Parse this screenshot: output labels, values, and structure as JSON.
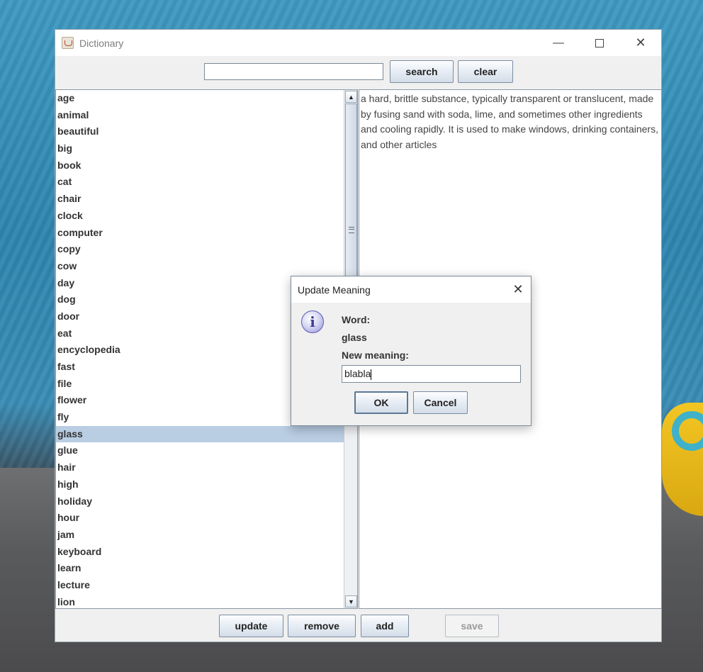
{
  "window": {
    "title": "Dictionary",
    "minimize": "—",
    "close": "✕"
  },
  "toolbar": {
    "search_value": "",
    "search_label": "search",
    "clear_label": "clear"
  },
  "words": [
    "age",
    "animal",
    "beautiful",
    "big",
    "book",
    "cat",
    "chair",
    "clock",
    "computer",
    "copy",
    "cow",
    "day",
    "dog",
    "door",
    "eat",
    "encyclopedia",
    "fast",
    "file",
    "flower",
    "fly",
    "glass",
    "glue",
    "hair",
    "high",
    "holiday",
    "hour",
    "jam",
    "keyboard",
    "learn",
    "lecture",
    "lion"
  ],
  "selected_word": "glass",
  "meaning": "a hard, brittle substance, typically transparent or translucent, made by fusing sand with soda, lime, and sometimes other ingredients and cooling rapidly. It is used to make windows, drinking containers, and other articles",
  "scrollbar": {
    "up": "▲",
    "down": "▼"
  },
  "actions": {
    "update": "update",
    "remove": "remove",
    "add": "add",
    "save": "save"
  },
  "dialog": {
    "title": "Update Meaning",
    "close": "✕",
    "icon": "i",
    "word_label": "Word:",
    "word_value": "glass",
    "meaning_label": "New meaning:",
    "meaning_value": "blabla",
    "ok": "OK",
    "cancel": "Cancel"
  }
}
